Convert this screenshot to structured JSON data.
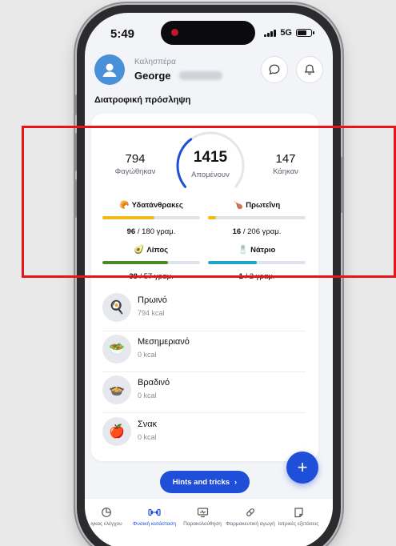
{
  "status": {
    "time": "5:49",
    "network": "5G"
  },
  "header": {
    "greeting": "Καλησπέρα",
    "username": "George"
  },
  "section_title": "Διατροφική πρόσληψη",
  "summary": {
    "eaten_value": "794",
    "eaten_label": "Φαγώθηκαν",
    "remaining_value": "1415",
    "remaining_label": "Απομένουν",
    "burned_value": "147",
    "burned_label": "Κάηκαν",
    "remaining_fraction": 0.36
  },
  "macros": [
    {
      "name": "Υδατάνθρακες",
      "consumed": "96",
      "total": "/ 180 γραμ.",
      "fraction": 0.53,
      "color": "#f5b915",
      "icon": "bread-icon"
    },
    {
      "name": "Πρωτεΐνη",
      "consumed": "16",
      "total": "/ 206 γραμ.",
      "fraction": 0.08,
      "color": "#f5b915",
      "icon": "drumstick-icon"
    },
    {
      "name": "Λίπος",
      "consumed": "38",
      "total": "/ 57 γραμ.",
      "fraction": 0.67,
      "color": "#4c8a23",
      "icon": "avocado-icon"
    },
    {
      "name": "Νάτριο",
      "consumed": "1",
      "total": "/ 2 γραμ.",
      "fraction": 0.5,
      "color": "#19a7c8",
      "icon": "salt-shaker-icon"
    }
  ],
  "meals": [
    {
      "name": "Πρωινό",
      "kcal": "794 kcal",
      "icon": "breakfast-pan-icon"
    },
    {
      "name": "Μεσημεριανό",
      "kcal": "0 kcal",
      "icon": "salad-bowl-icon"
    },
    {
      "name": "Βραδινό",
      "kcal": "0 kcal",
      "icon": "dinner-plate-icon"
    },
    {
      "name": "Σνακ",
      "kcal": "0 kcal",
      "icon": "apple-icon"
    }
  ],
  "hints_label": "Hints and tricks",
  "tabs": [
    {
      "label": "ιγκας ελέγχου",
      "icon": "chart-icon",
      "active": false
    },
    {
      "label": "Φυσική κατάσταση",
      "icon": "dumbbell-icon",
      "active": true
    },
    {
      "label": "Παρακολούθηση",
      "icon": "monitor-icon",
      "active": false
    },
    {
      "label": "Φαρμακευτική αγωγή",
      "icon": "pill-icon",
      "active": false
    },
    {
      "label": "Ιατρικές εξετάσεις",
      "icon": "clipboard-icon",
      "active": false
    }
  ],
  "colors": {
    "accent": "#1f4ed8",
    "annotation": "#e8141a"
  }
}
